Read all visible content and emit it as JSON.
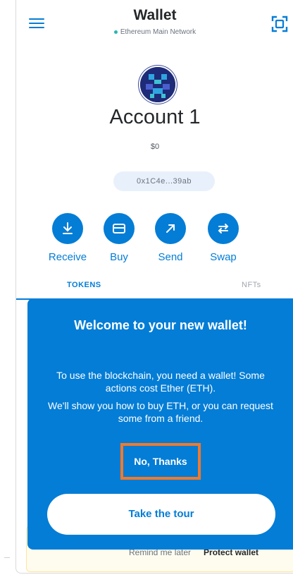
{
  "header": {
    "title": "Wallet",
    "network": "Ethereum Main Network",
    "menu_icon": "hamburger-icon",
    "scan_icon": "qr-scan-icon"
  },
  "account": {
    "name": "Account 1",
    "balance": "$0",
    "address": "0x1C4e...39ab"
  },
  "actions": [
    {
      "label": "Receive",
      "icon": "receive-icon"
    },
    {
      "label": "Buy",
      "icon": "card-icon"
    },
    {
      "label": "Send",
      "icon": "send-arrow-icon"
    },
    {
      "label": "Swap",
      "icon": "swap-icon"
    }
  ],
  "tabs": [
    {
      "label": "TOKENS",
      "active": true
    },
    {
      "label": "NFTs",
      "active": false
    }
  ],
  "background_banner": {
    "remind": "Remind me later",
    "protect": "Protect wallet"
  },
  "modal": {
    "title": "Welcome to your new wallet!",
    "text_1": "To use the blockchain, you need a wallet! Some actions cost Ether (ETH).",
    "text_2": "We'll show you how to buy ETH, or you can request some from a friend.",
    "no_thanks": "No, Thanks",
    "tour": "Take the tour"
  },
  "colors": {
    "primary": "#037dd6",
    "highlight_border": "#f1792c",
    "banner_bg": "#fefcef"
  }
}
